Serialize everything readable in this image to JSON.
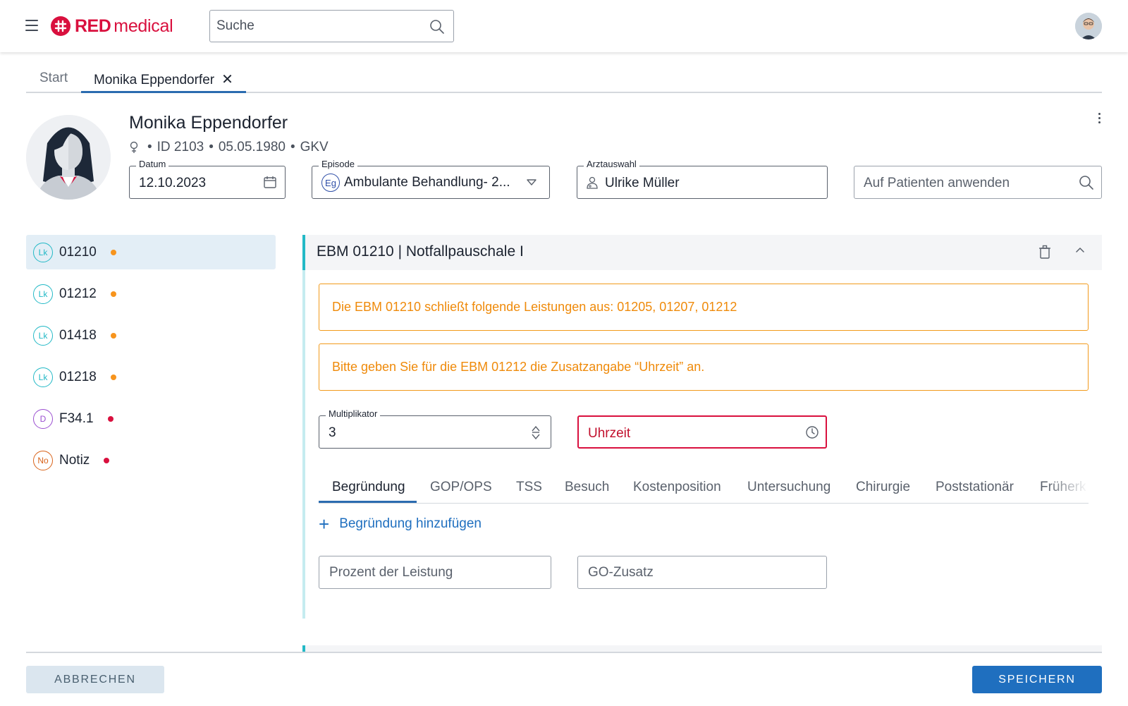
{
  "header": {
    "logo_bold": "RED",
    "logo_light": "medical",
    "search_placeholder": "Suche"
  },
  "tabs": [
    {
      "label": "Start",
      "active": false
    },
    {
      "label": "Monika Eppendorfer",
      "active": true
    }
  ],
  "patient": {
    "name": "Monika Eppendorfer",
    "id": "ID 2103",
    "dob": "05.05.1980",
    "insurance": "GKV",
    "gender_icon": "female-icon"
  },
  "fields": {
    "datum": {
      "label": "Datum",
      "value": "12.10.2023"
    },
    "episode": {
      "label": "Episode",
      "badge": "Eg",
      "value": "Ambulante Behandlung- 2..."
    },
    "arzt": {
      "label": "Arztauswahl",
      "value": "Ulrike Müller"
    },
    "apply_placeholder": "Auf Patienten anwenden"
  },
  "list": [
    {
      "badge": "Lk",
      "code": "01210",
      "badge_color": "#23b9c6",
      "dot_color": "#f7941d",
      "active": true
    },
    {
      "badge": "Lk",
      "code": "01212",
      "badge_color": "#23b9c6",
      "dot_color": "#f7941d",
      "active": false
    },
    {
      "badge": "Lk",
      "code": "01418",
      "badge_color": "#23b9c6",
      "dot_color": "#f7941d",
      "active": false
    },
    {
      "badge": "Lk",
      "code": "01218",
      "badge_color": "#23b9c6",
      "dot_color": "#f7941d",
      "active": false
    },
    {
      "badge": "D",
      "code": "F34.1",
      "badge_color": "#9b4fd1",
      "dot_color": "#d9103e",
      "active": false
    },
    {
      "badge": "No",
      "code": "Notiz",
      "badge_color": "#d9631a",
      "dot_color": "#d9103e",
      "active": false
    }
  ],
  "panel": {
    "title": "EBM 01210 | Notfallpauschale I",
    "alerts": [
      "Die EBM 01210 schließt folgende Leistungen aus: 01205, 01207, 01212",
      "Bitte geben Sie für die EBM 01212 die Zusatzangabe “Uhrzeit” an."
    ],
    "multiplikator": {
      "label": "Multiplikator",
      "value": "3"
    },
    "uhrzeit": "Uhrzeit",
    "subtabs": [
      "Begründung",
      "GOP/OPS",
      "TSS",
      "Besuch",
      "Kostenposition",
      "Untersuchung",
      "Chirurgie",
      "Poststationär",
      "Früherk"
    ],
    "add_label": "Begründung hinzufügen",
    "prozent_placeholder": "Prozent der Leistung",
    "gozusatz_placeholder": "GO-Zusatz"
  },
  "footer": {
    "cancel": "ABBRECHEN",
    "save": "SPEICHERN"
  },
  "colors": {
    "brand": "#d9103e",
    "accent": "#1f6fbf",
    "warning": "#f29a1b",
    "teal": "#23b9c6"
  }
}
